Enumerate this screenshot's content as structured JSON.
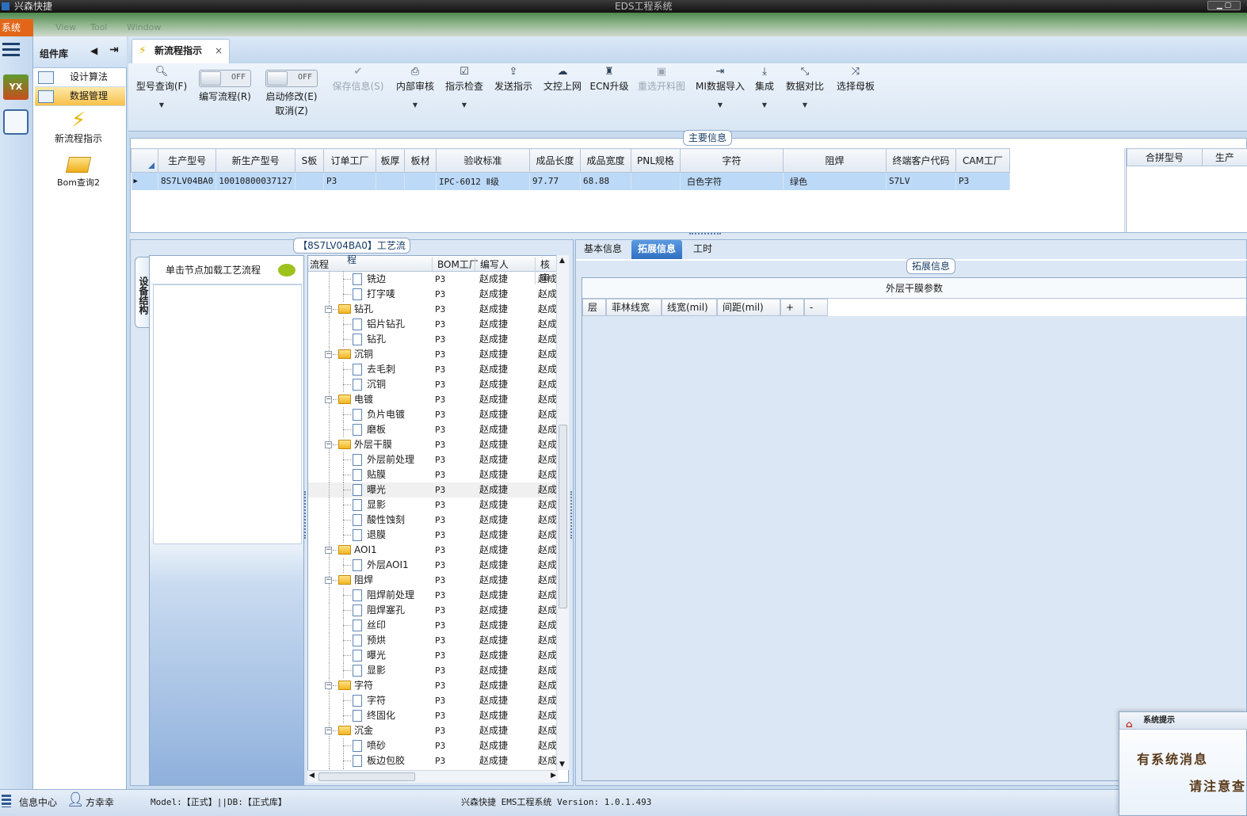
{
  "window": {
    "app_title": "兴森快捷",
    "title": "EDS工程系统",
    "system_menu": "系统"
  },
  "menubar_ghost": [
    "View",
    "Tool",
    "Window"
  ],
  "component_library": {
    "title": "组件库",
    "nav_items": [
      {
        "label": "设计算法",
        "active": false
      },
      {
        "label": "数据管理",
        "active": true
      }
    ],
    "tools": [
      {
        "label": "新流程指示",
        "icon": "lightning-icon"
      },
      {
        "label": "Bom查询2",
        "icon": "open-folder-icon"
      }
    ]
  },
  "document_tab": {
    "label": "新流程指示",
    "close": "×"
  },
  "ribbon": {
    "model_query": "型号查询(F)",
    "toggle1": {
      "state": "OFF",
      "label": "编写流程(R)"
    },
    "toggle2": {
      "state": "OFF",
      "label": "启动修改(E)",
      "sublabel": "取消(Z)"
    },
    "buttons": [
      {
        "label": "保存信息(S)",
        "icon": "✔",
        "disabled": true,
        "dropdown": false
      },
      {
        "label": "内部审核",
        "icon": "⎙",
        "disabled": false,
        "dropdown": true
      },
      {
        "label": "指示检查",
        "icon": "☑",
        "disabled": false,
        "dropdown": true
      },
      {
        "label": "发送指示",
        "icon": "⇪",
        "disabled": false,
        "dropdown": false
      },
      {
        "label": "文控上网",
        "icon": "☁",
        "disabled": false,
        "dropdown": false
      },
      {
        "label": "ECN升级",
        "icon": "♜",
        "disabled": false,
        "dropdown": false
      },
      {
        "label": "重选开料图",
        "icon": "▣",
        "disabled": true,
        "dropdown": false
      },
      {
        "label": "MI数据导入",
        "icon": "⇥",
        "disabled": false,
        "dropdown": true
      },
      {
        "label": "集成",
        "icon": "⤓",
        "disabled": false,
        "dropdown": true
      },
      {
        "label": "数据对比",
        "icon": "⤡",
        "disabled": false,
        "dropdown": true
      },
      {
        "label": "选择母板",
        "icon": "⤨",
        "disabled": false,
        "dropdown": false
      }
    ]
  },
  "main_info": {
    "title": "主要信息",
    "columns": [
      "生产型号",
      "新生产型号",
      "S板",
      "订单工厂",
      "板厚",
      "板材",
      "验收标准",
      "成品长度",
      "成品宽度",
      "PNL规格",
      "字符",
      "阻焊",
      "终端客户代码",
      "CAM工厂"
    ],
    "row": [
      "8S7LV04BA0",
      "10010800037127",
      "",
      "P3",
      "",
      "",
      "IPC-6012 Ⅱ级",
      "97.77",
      "68.88",
      "",
      "白色字符",
      "绿色",
      "S7LV",
      "P3"
    ],
    "side_columns": [
      "合拼型号",
      "生产"
    ]
  },
  "process_panel": {
    "title": "【8S7LV04BA0】工艺流程",
    "vertical_tab": "设备结构",
    "click_hint": "单击节点加载工艺流程",
    "tree_headers": [
      "流程",
      "BOM工厂",
      "编写人",
      "核审"
    ],
    "factory": "P3",
    "writer": "赵成捷",
    "reviewer": "赵成",
    "rows": [
      {
        "label": "铣边",
        "type": "doc",
        "level": 1
      },
      {
        "label": "打字唛",
        "type": "doc",
        "level": 1
      },
      {
        "label": "钻孔",
        "type": "folder",
        "level": 0
      },
      {
        "label": "铝片钻孔",
        "type": "doc",
        "level": 1
      },
      {
        "label": "钻孔",
        "type": "doc",
        "level": 1
      },
      {
        "label": "沉铜",
        "type": "folder",
        "level": 0
      },
      {
        "label": "去毛刺",
        "type": "doc",
        "level": 1
      },
      {
        "label": "沉铜",
        "type": "doc",
        "level": 1
      },
      {
        "label": "电镀",
        "type": "folder",
        "level": 0
      },
      {
        "label": "负片电镀",
        "type": "doc",
        "level": 1
      },
      {
        "label": "磨板",
        "type": "doc",
        "level": 1
      },
      {
        "label": "外层干膜",
        "type": "folder",
        "level": 0
      },
      {
        "label": "外层前处理",
        "type": "doc",
        "level": 1
      },
      {
        "label": "贴膜",
        "type": "doc",
        "level": 1
      },
      {
        "label": "曝光",
        "type": "doc",
        "level": 1,
        "highlight": true
      },
      {
        "label": "显影",
        "type": "doc",
        "level": 1
      },
      {
        "label": "酸性蚀刻",
        "type": "doc",
        "level": 1
      },
      {
        "label": "退膜",
        "type": "doc",
        "level": 1
      },
      {
        "label": "AOI1",
        "type": "folder",
        "level": 0
      },
      {
        "label": "外层AOI1",
        "type": "doc",
        "level": 1
      },
      {
        "label": "阻焊",
        "type": "folder",
        "level": 0
      },
      {
        "label": "阻焊前处理",
        "type": "doc",
        "level": 1
      },
      {
        "label": "阻焊塞孔",
        "type": "doc",
        "level": 1
      },
      {
        "label": "丝印",
        "type": "doc",
        "level": 1
      },
      {
        "label": "预烘",
        "type": "doc",
        "level": 1
      },
      {
        "label": "曝光",
        "type": "doc",
        "level": 1
      },
      {
        "label": "显影",
        "type": "doc",
        "level": 1
      },
      {
        "label": "字符",
        "type": "folder",
        "level": 0
      },
      {
        "label": "字符",
        "type": "doc",
        "level": 1
      },
      {
        "label": "终固化",
        "type": "doc",
        "level": 1
      },
      {
        "label": "沉金",
        "type": "folder",
        "level": 0
      },
      {
        "label": "喷砂",
        "type": "doc",
        "level": 1
      },
      {
        "label": "板边包胶",
        "type": "doc",
        "level": 1
      },
      {
        "label": "沉金",
        "type": "doc",
        "level": 1
      }
    ]
  },
  "right_panel": {
    "tabs": [
      {
        "label": "基本信息",
        "active": false
      },
      {
        "label": "拓展信息",
        "active": true
      },
      {
        "label": "工时",
        "active": false
      }
    ],
    "group_title": "拓展信息",
    "params_title": "外层干膜参数",
    "param_columns": [
      "层",
      "菲林线宽",
      "线宽(mil)",
      "间距(mil)",
      "+",
      "-"
    ]
  },
  "status": {
    "info_center": "信息中心",
    "user": "方幸幸",
    "model_db": "Model:【正式】||DB:【正式库】",
    "version": "兴森快捷 EMS工程系统 Version: 1.0.1.493"
  },
  "popup": {
    "title": "系统提示",
    "line1": "有系统消息",
    "line2": "请注意查"
  }
}
